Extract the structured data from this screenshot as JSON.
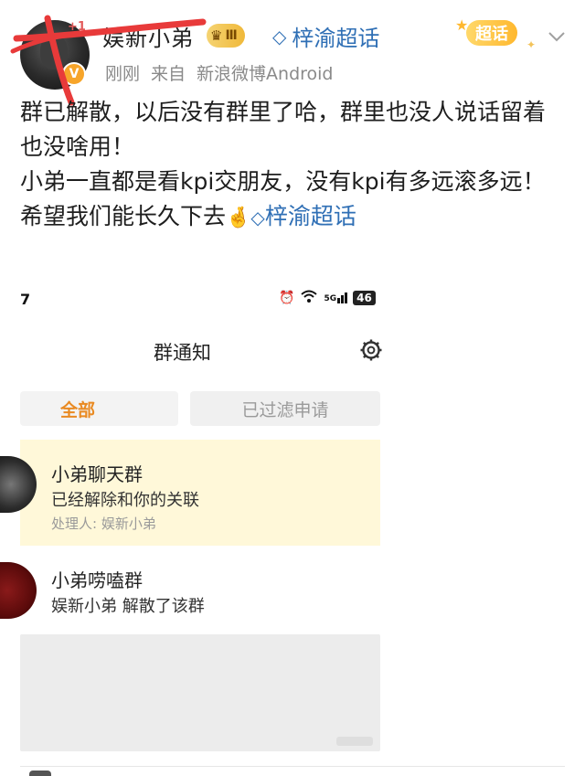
{
  "post": {
    "username": "娱新小弟",
    "level_badge": "Ⅲ",
    "plus_one": "+1",
    "topic_header": "梓渝超话",
    "time": "刚刚",
    "source_prefix": "来自",
    "source": "新浪微博Android",
    "supertopic_sticker": "超话",
    "lines": [
      "群已解散，以后没有群里了哈，群里也没人说话留着也没啥用！",
      "小弟一直都是看kpi交朋友，没有kpi有多远滚多远！",
      "希望我们能长久下去"
    ],
    "hand_emoji": "🤞",
    "inline_topic": "梓渝超话"
  },
  "screenshot": {
    "status_time": "7",
    "status_signal": "5G",
    "battery": "46",
    "title": "群通知",
    "tabs": [
      {
        "label": "全部",
        "active": true
      },
      {
        "label": "已过滤申请",
        "active": false
      }
    ],
    "notices": [
      {
        "group": "小弟聊天群",
        "message": "已经解除和你的关联",
        "handler": "处理人: 娱新小弟"
      },
      {
        "group": "小弟唠嗑群",
        "message": "娱新小弟 解散了该群"
      }
    ]
  },
  "colors": {
    "link_blue": "#2f6fb5",
    "accent_orange": "#e98a22",
    "notice_highlight": "#fff8d9",
    "scribble_red": "#e83a3a"
  },
  "icons": [
    "avatar-verified-icon",
    "crown-icon",
    "diamond-icon",
    "chevron-down-icon",
    "gear-icon",
    "alarm-icon",
    "wifi-icon",
    "signal-icon",
    "battery-icon"
  ]
}
